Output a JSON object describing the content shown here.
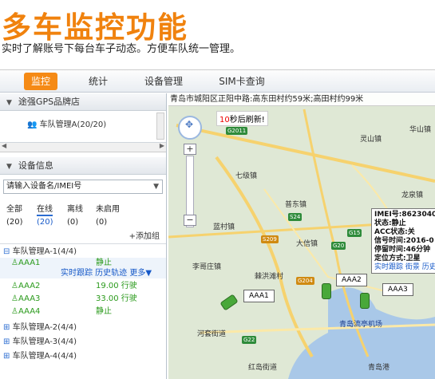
{
  "banner": {
    "title": "多车监控功能",
    "subtitle": "实时了解账号下每台车子动态。方便车队统一管理。"
  },
  "nav": {
    "tabs": [
      "监控",
      "统计",
      "设备管理",
      "SIM卡查询"
    ],
    "active": "监控"
  },
  "left": {
    "panel1_title": "途强GPS品牌店",
    "fleet_node": "车队管理A(20/20)",
    "panel2_title": "设备信息",
    "device_select_placeholder": "请输入设备名/IMEI号",
    "status_tabs": [
      "全部",
      "在线",
      "离线",
      "未启用"
    ],
    "status_counts": [
      "(20)",
      "(20)",
      "(0)",
      "(0)"
    ],
    "add_group": "+添加组",
    "groups": [
      {
        "name": "车队管理A-1(4/4)"
      },
      {
        "name": "车队管理A-2(4/4)"
      },
      {
        "name": "车队管理A-3(4/4)"
      },
      {
        "name": "车队管理A-4(4/4)"
      }
    ],
    "vehicles": [
      {
        "name": "AAA1",
        "status": "静止"
      },
      {
        "name": "AAA2",
        "status": "19.00 行驶"
      },
      {
        "name": "AAA3",
        "status": "33.00 行驶"
      },
      {
        "name": "AAA4",
        "status": "静止"
      }
    ],
    "vehicle_actions": "实时跟踪 历史轨迹 更多▼"
  },
  "map": {
    "address": "青岛市城阳区正阳中路:高东田村约59米;高田村约99米",
    "refresh_count": "10",
    "refresh_text": "秒后刷新!",
    "places": [
      "华山镇",
      "灵山镇",
      "七级镇",
      "普东镇",
      "蓝村镇",
      "大信镇",
      "李哥庄镇",
      "棘洪滩村",
      "河套街道",
      "龙泉镇",
      "青岛流亭机场",
      "红岛街道",
      "青岛港"
    ],
    "roads": [
      "G2011",
      "S24",
      "S209",
      "G20",
      "G204",
      "G22",
      "G15"
    ],
    "car_labels": [
      "AAA1",
      "AAA2",
      "AAA3"
    ],
    "info_window": {
      "imei": "IMEI号:86230402",
      "status": "状态:静止",
      "acc": "ACC状态:关",
      "signal": "信号时间:2016-0",
      "stay": "停留时间:46分钟",
      "locate": "定位方式:卫星",
      "links": "实时跟踪 街景 历史"
    },
    "colors": {
      "accent": "#f58a15",
      "road": "#2e8b3a",
      "water": "#a9c8e8"
    }
  }
}
